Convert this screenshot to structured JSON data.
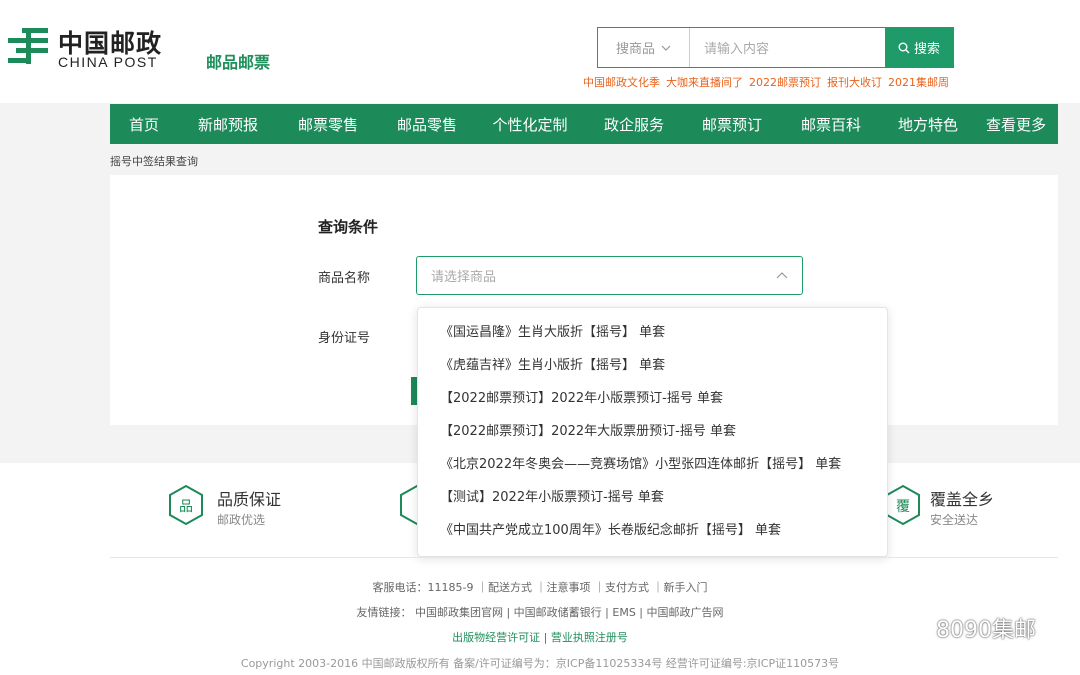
{
  "header": {
    "brand_cn": "中国邮政",
    "brand_en": "CHINA POST",
    "subbrand": "邮品邮票",
    "search": {
      "category": "搜商品",
      "placeholder": "请输入内容",
      "button": "搜索"
    },
    "hot_words": [
      "中国邮政文化季",
      "大咖来直播间了",
      "2022邮票预订",
      "报刊大收订",
      "2021集邮周"
    ]
  },
  "nav": [
    "首页",
    "新邮预报",
    "邮票零售",
    "邮品零售",
    "个性化定制",
    "政企服务",
    "邮票预订",
    "邮票百科",
    "地方特色",
    "查看更多"
  ],
  "breadcrumb": "摇号中签结果查询",
  "form": {
    "title": "查询条件",
    "product_label": "商品名称",
    "product_placeholder": "请选择商品",
    "id_label": "身份证号"
  },
  "dropdown": {
    "options": [
      "《国运昌隆》生肖大版折【摇号】 单套",
      "《虎蕴吉祥》生肖小版折【摇号】 单套",
      "【2022邮票预订】2022年小版票预订-摇号 单套",
      "【2022邮票预订】2022年大版票册预订-摇号 单套",
      "《北京2022年冬奥会——竞赛场馆》小型张四连体邮折【摇号】 单套",
      "【测试】2022年小版票预订-摇号 单套",
      "《中国共产党成立100周年》长卷版纪念邮折【摇号】 单套"
    ]
  },
  "features": [
    {
      "icon_char": "品",
      "title": "品质保证",
      "sub": "邮政优选"
    },
    {
      "icon_char": "覆",
      "title": "覆盖全乡",
      "sub": "安全送达"
    }
  ],
  "footer": {
    "service": "客服电话：11185-9 ｜配送方式 ｜注意事项 ｜支付方式 ｜新手入门",
    "links": "友情链接： 中国邮政集团官网 | 中国邮政储蓄银行 | EMS | 中国邮政广告网",
    "licenses": "出版物经营许可证 | 营业执照注册号",
    "copyright": "Copyright 2003-2016 中国邮政版权所有 备案/许可证编号为：京ICP备11025334号   经营许可证编号:京ICP证110573号"
  },
  "watermark": "8090集邮",
  "colors": {
    "brand_green": "#1d8a5a",
    "accent_orange": "#e8631c",
    "band_gray": "#f3f3f3"
  }
}
